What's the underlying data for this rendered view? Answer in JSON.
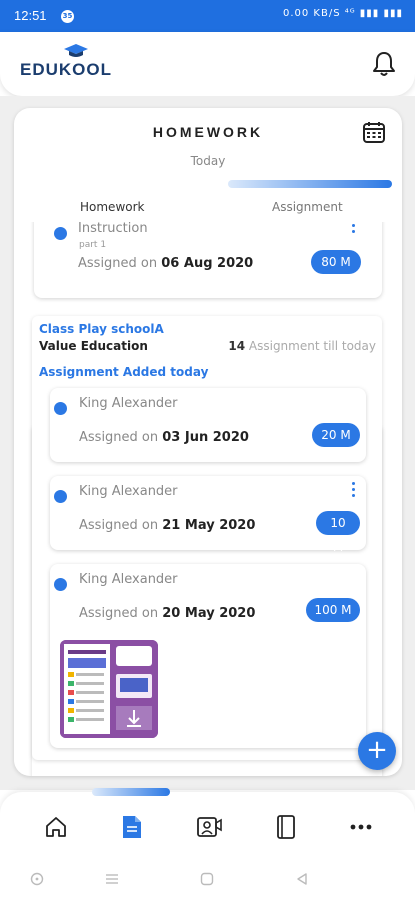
{
  "status_bar": {
    "time": "12:51",
    "notification_badge": "35",
    "indicators": "0.00 KB/S ⁴ᴳ ▮▮▮ ▮▮▮"
  },
  "header": {
    "logo_text": "EDUKOOL",
    "bell_icon": "bell-icon"
  },
  "page": {
    "title": "HOMEWORK",
    "date_label": "Today",
    "calendar_icon": "calendar-icon",
    "tabs": [
      {
        "label": "Homework",
        "active": false
      },
      {
        "label": "Assignment",
        "active": true
      }
    ]
  },
  "top_card": {
    "name": "Instruction",
    "subtitle": "part 1",
    "assigned_prefix": "Assigned on",
    "assigned_date": "06 Aug 2020",
    "marks": "80 M"
  },
  "group": {
    "school": "Class Play schoolA",
    "subject": "Value Education",
    "count_number": "14",
    "count_text": "Assignment till today",
    "section_title": "Assignment Added today",
    "items": [
      {
        "name": "King Alexander",
        "assigned_prefix": "Assigned on",
        "assigned_date": "03 Jun 2020",
        "marks": "20 M"
      },
      {
        "name": "King Alexander",
        "assigned_prefix": "Assigned on",
        "assigned_date": "21 May 2020",
        "marks": "10 M"
      },
      {
        "name": "King Alexander",
        "assigned_prefix": "Assigned on",
        "assigned_date": "20 May 2020",
        "marks": "100 M"
      }
    ]
  },
  "fab_label": "+",
  "bottom_nav": {
    "items": [
      {
        "icon": "home-icon"
      },
      {
        "icon": "document-icon",
        "active": true
      },
      {
        "icon": "video-class-icon"
      },
      {
        "icon": "book-icon"
      },
      {
        "icon": "more-icon"
      }
    ]
  },
  "colors": {
    "primary": "#2b78e4",
    "status_bar": "#1f6fe0",
    "logo": "#1b3d6e"
  }
}
